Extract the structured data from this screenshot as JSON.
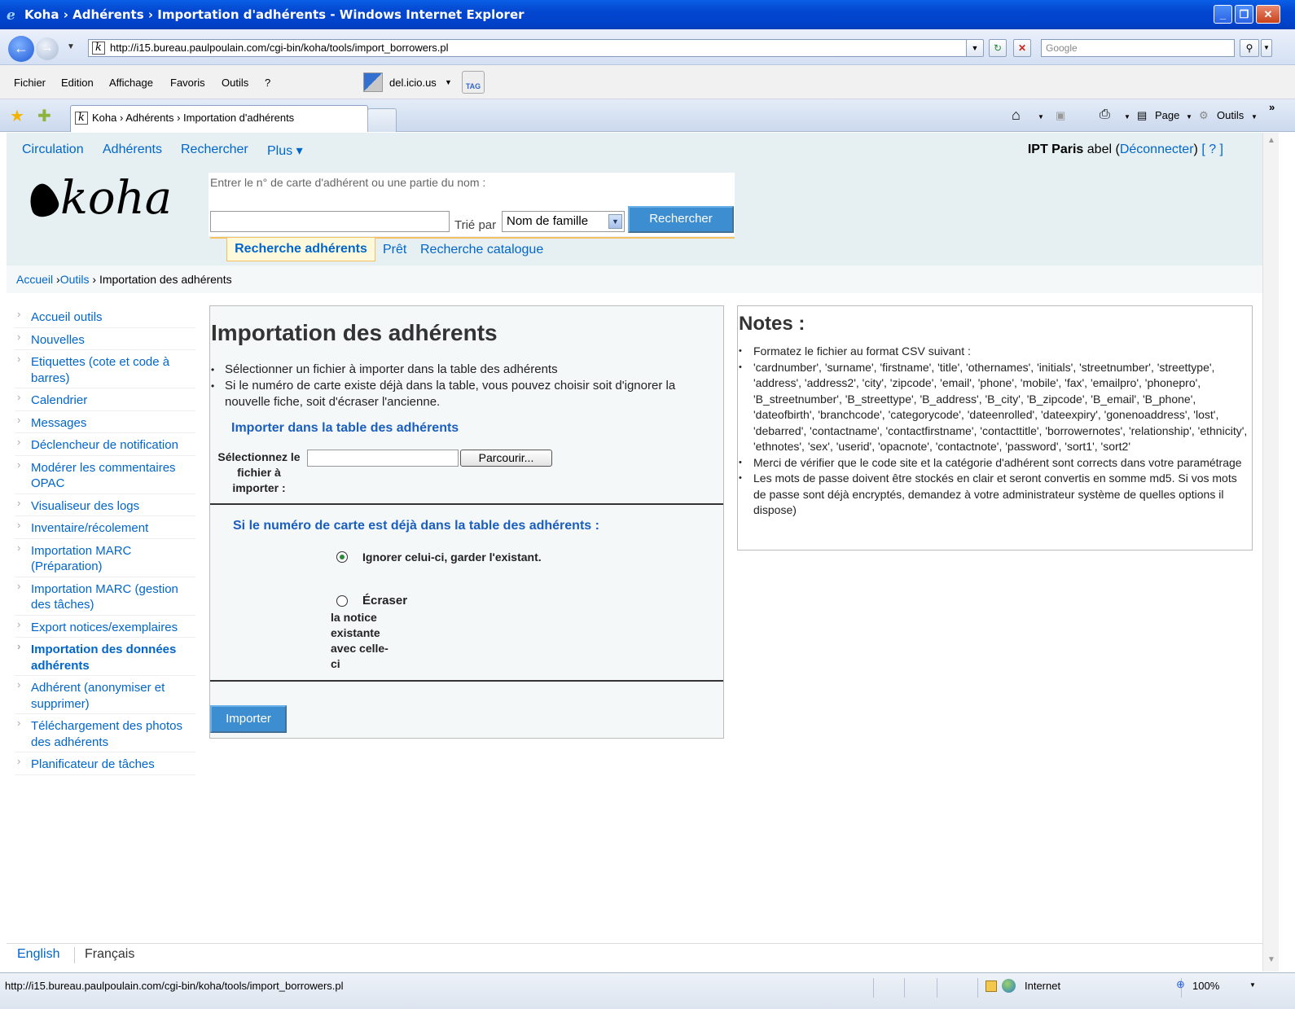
{
  "window": {
    "title": "Koha › Adhérents › Importation d'adhérents - Windows Internet Explorer",
    "controls": {
      "minimize": "_",
      "maximize": "❐",
      "close": "✕"
    }
  },
  "addressbar": {
    "url": "http://i15.bureau.paulpoulain.com/cgi-bin/koha/tools/import_borrowers.pl",
    "search_placeholder": "Google"
  },
  "menubar": {
    "items": [
      "Fichier",
      "Edition",
      "Affichage",
      "Favoris",
      "Outils",
      "?"
    ],
    "delicious_label": "del.icio.us",
    "tag_label": "TAG"
  },
  "tabbar": {
    "active_tab": "Koha › Adhérents › Importation d'adhérents",
    "commands": {
      "page": "Page",
      "tools": "Outils"
    }
  },
  "topnav": {
    "items": [
      "Circulation",
      "Adhérents",
      "Rechercher",
      "Plus ▾"
    ],
    "branch": "IPT Paris",
    "user": "abel",
    "logout": "Déconnecter",
    "help": "[ ? ]"
  },
  "header": {
    "logo_text": "koha",
    "search_label": "Entrer le n° de carte d'adhérent ou une partie du nom :",
    "sort_label": "Trié par",
    "sort_value": "Nom de famille",
    "search_button": "Rechercher",
    "tabs": [
      "Recherche adhérents",
      "Prêt",
      "Recherche catalogue"
    ]
  },
  "breadcrumb": {
    "items": [
      "Accueil",
      "Outils"
    ],
    "current": "Importation des adhérents",
    "sep": " ›"
  },
  "leftnav": {
    "items": [
      "Accueil outils",
      "Nouvelles",
      "Etiquettes (cote et code à barres)",
      "Calendrier",
      "Messages",
      "Déclencheur de notification",
      "Modérer les commentaires OPAC",
      "Visualiseur des logs",
      "Inventaire/récolement",
      "Importation MARC (Préparation)",
      "Importation MARC (gestion des tâches)",
      "Export notices/exemplaires",
      "Importation des données adhérents",
      "Adhérent (anonymiser et supprimer)",
      "Téléchargement des photos des adhérents",
      "Planificateur de tâches"
    ],
    "current_index": 12
  },
  "main": {
    "title": "Importation des adhérents",
    "bullets": [
      "Sélectionner un fichier à importer dans la table des adhérents",
      "Si le numéro de carte existe déjà dans la table, vous pouvez choisir soit d'ignorer la nouvelle fiche, soit d'écraser l'ancienne."
    ],
    "fieldset1_legend": "Importer dans la table des adhérents",
    "file_label": "Sélectionnez le fichier à importer :",
    "browse_button": "Parcourir...",
    "fieldset2_legend": "Si le numéro de carte est déjà dans la table des adhérents :",
    "radio_ignore": "Ignorer celui-ci, garder l'existant.",
    "radio_overwrite": "Écraser",
    "radio_overwrite_desc": "la notice existante avec celle-ci",
    "radio_selected": "ignore",
    "import_button": "Importer"
  },
  "notes": {
    "title": "Notes :",
    "items": [
      "Formatez le fichier au format CSV suivant :",
      "'cardnumber', 'surname', 'firstname', 'title', 'othernames', 'initials', 'streetnumber', 'streettype', 'address', 'address2', 'city', 'zipcode', 'email', 'phone', 'mobile', 'fax', 'emailpro', 'phonepro', 'B_streetnumber', 'B_streettype', 'B_address', 'B_city', 'B_zipcode', 'B_email', 'B_phone', 'dateofbirth', 'branchcode', 'categorycode', 'dateenrolled', 'dateexpiry', 'gonenoaddress', 'lost', 'debarred', 'contactname', 'contactfirstname', 'contacttitle', 'borrowernotes', 'relationship', 'ethnicity', 'ethnotes', 'sex', 'userid', 'opacnote', 'contactnote', 'password', 'sort1', 'sort2'",
      "Merci de vérifier que le code site et la catégorie d'adhérent sont corrects dans votre paramétrage",
      "Les mots de passe doivent être stockés en clair et seront convertis en somme md5. Si vos mots de passe sont déjà encryptés, demandez à votre administrateur système de quelles options il dispose)"
    ]
  },
  "footer": {
    "languages": [
      "English",
      "Français"
    ]
  },
  "statusbar": {
    "text": "http://i15.bureau.paulpoulain.com/cgi-bin/koha/tools/import_borrowers.pl",
    "zone": "Internet",
    "zoom": "100%"
  },
  "colors": {
    "link": "#0066cc",
    "header_bg": "#e6f0f2",
    "button_blue": "#3d8ed0",
    "legend_blue": "#1a5ec0",
    "tab_highlight": "#f5c05d"
  },
  "icons": [
    "ie-logo-icon",
    "back-icon",
    "forward-icon",
    "refresh-icon",
    "stop-icon",
    "search-icon",
    "star-icon",
    "add-favorite-icon",
    "home-icon",
    "feeds-icon",
    "print-icon",
    "page-icon",
    "tools-icon",
    "koha-logo",
    "internet-zone-icon",
    "zoom-icon"
  ]
}
